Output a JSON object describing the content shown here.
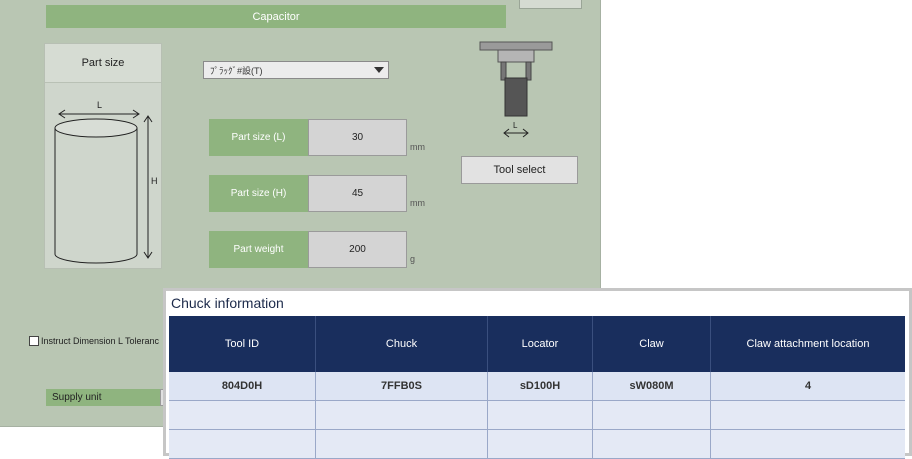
{
  "window": {
    "title": "Capacitor"
  },
  "part_size": {
    "header": "Part size",
    "diagram_label_l": "L",
    "diagram_label_h": "H"
  },
  "dropdown": {
    "selected": "ﾌﾟﾗｯｸﾞ#設(T)"
  },
  "fields": [
    {
      "label": "Part size (L)",
      "value": "30",
      "unit": "mm"
    },
    {
      "label": "Part size (H)",
      "value": "45",
      "unit": "mm"
    },
    {
      "label": "Part weight",
      "value": "200",
      "unit": "g"
    }
  ],
  "tool": {
    "label_l": "L",
    "select_label": "Tool select"
  },
  "instruct": {
    "label": "Instruct Dimension  L Toleranc"
  },
  "supply": {
    "label": "Supply unit"
  },
  "chuck_info": {
    "title": "Chuck information",
    "columns": [
      "Tool ID",
      "Chuck",
      "Locator",
      "Claw",
      "Claw attachment location"
    ],
    "rows": [
      [
        "804D0H",
        "7FFB0S",
        "sD100H",
        "sW080M",
        "4"
      ],
      [
        "",
        "",
        "",
        "",
        ""
      ],
      [
        "",
        "",
        "",
        "",
        ""
      ]
    ]
  }
}
